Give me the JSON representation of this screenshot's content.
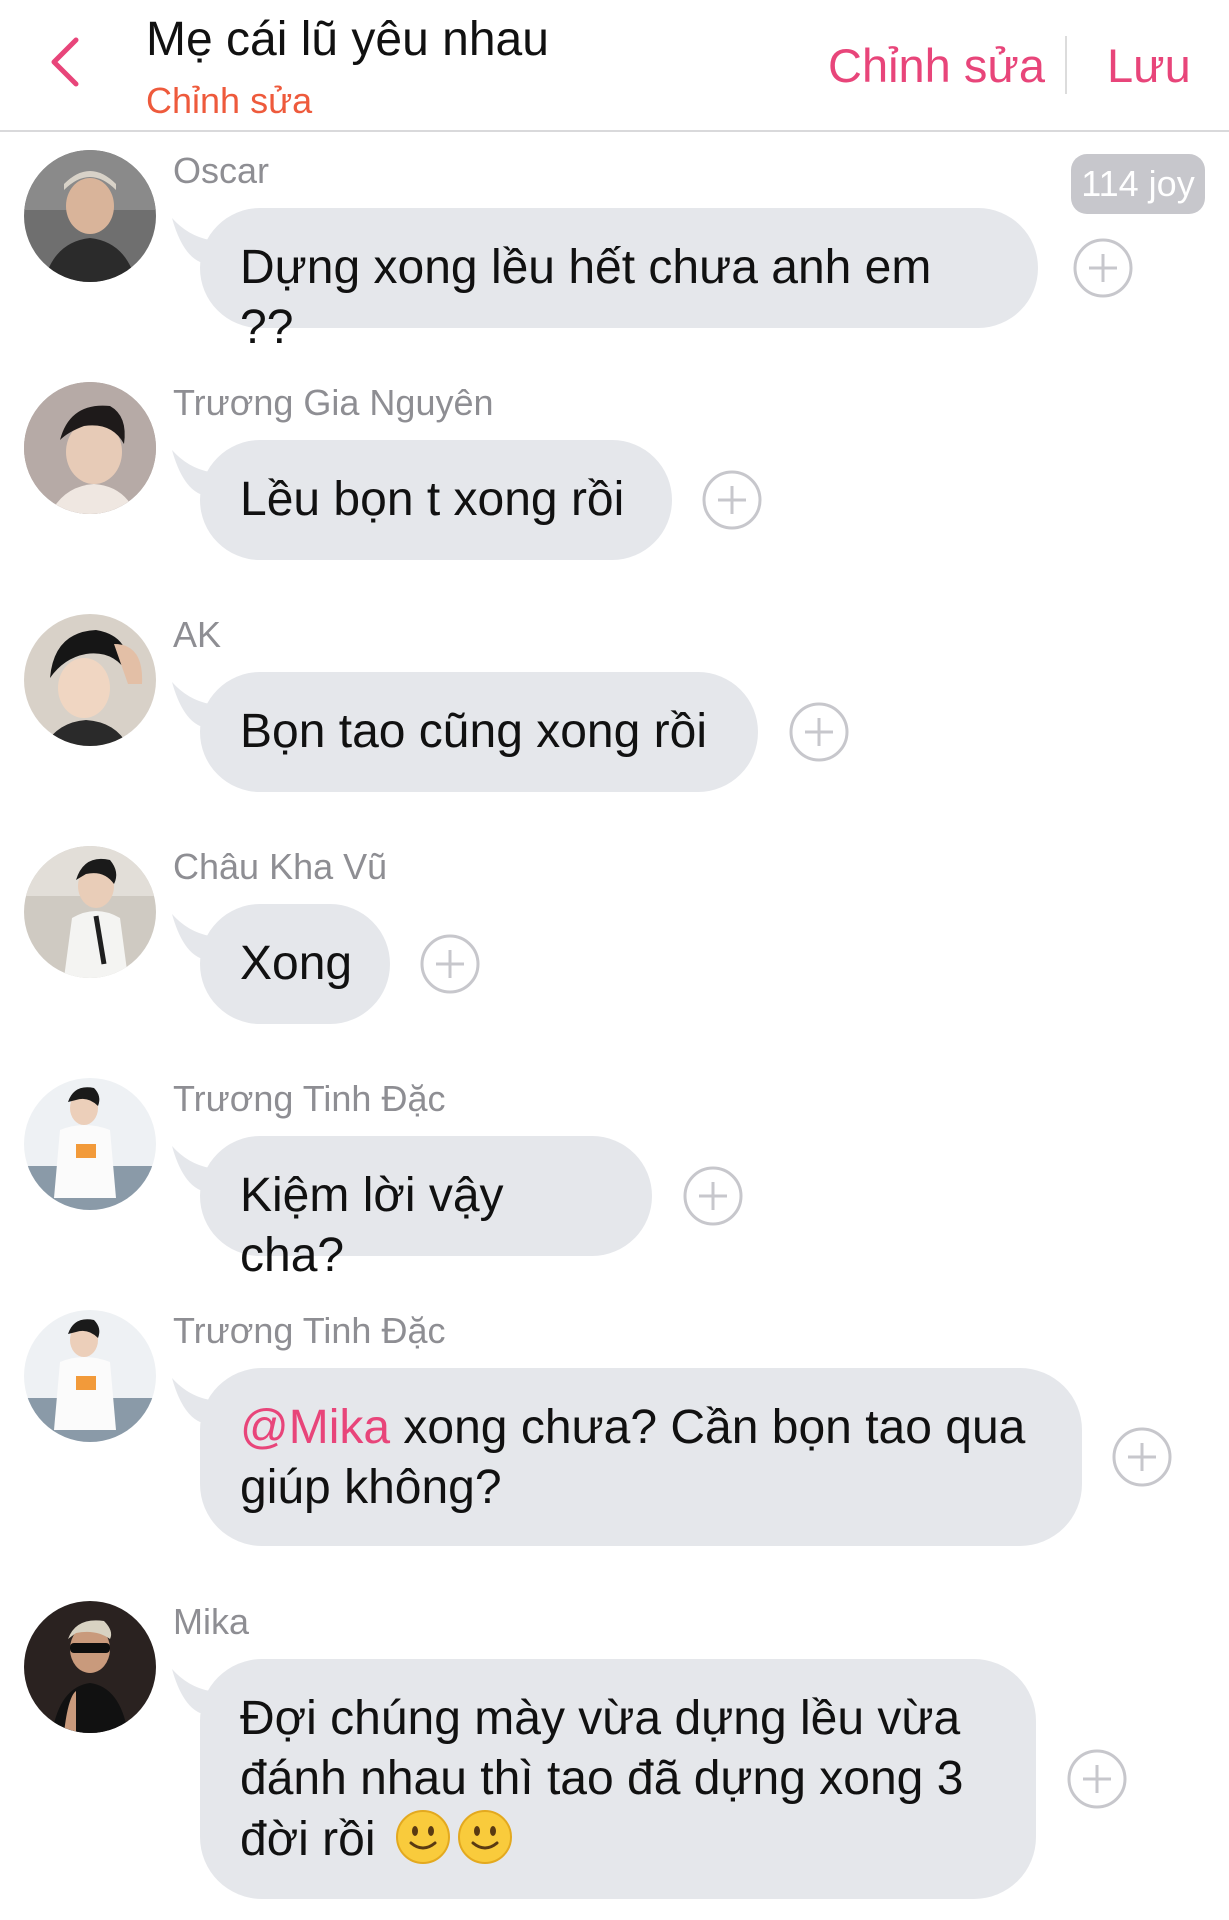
{
  "header": {
    "title": "Mẹ cái lũ yêu nhau",
    "subtitle": "Chỉnh sửa",
    "edit_label": "Chỉnh sửa",
    "save_label": "Lưu",
    "accent_color": "#e8457a",
    "subtitle_color": "#ee5a3c"
  },
  "badge": {
    "label": "114 joy"
  },
  "messages": [
    {
      "sender": "Oscar",
      "text": "Dựng xong lều hết chưa anh em ??"
    },
    {
      "sender": "Trương Gia Nguyên",
      "text": "Lều bọn t xong rồi"
    },
    {
      "sender": "AK",
      "text": "Bọn tao cũng xong rồi"
    },
    {
      "sender": "Châu Kha Vũ",
      "text": "Xong"
    },
    {
      "sender": "Trương Tinh Đặc",
      "text": "Kiệm lời vậy cha?"
    },
    {
      "sender": "Trương Tinh Đặc",
      "mention": "@Mika",
      "text": " xong chưa? Cần bọn tao qua giúp không?"
    },
    {
      "sender": "Mika",
      "text": "Đợi chúng mày vừa dựng lều vừa đánh nhau thì tao đã dựng xong 3 đời rồi",
      "emojis": [
        "slightly-smiling-face",
        "slightly-smiling-face"
      ]
    }
  ],
  "icons": {
    "back": "chevron-left-icon",
    "add": "plus-circle-icon",
    "emoji": "slightly-smiling-face"
  },
  "colors": {
    "bubble": "#e5e7eb",
    "sender_name": "#8e8e93",
    "badge": "#c7c7cc"
  }
}
